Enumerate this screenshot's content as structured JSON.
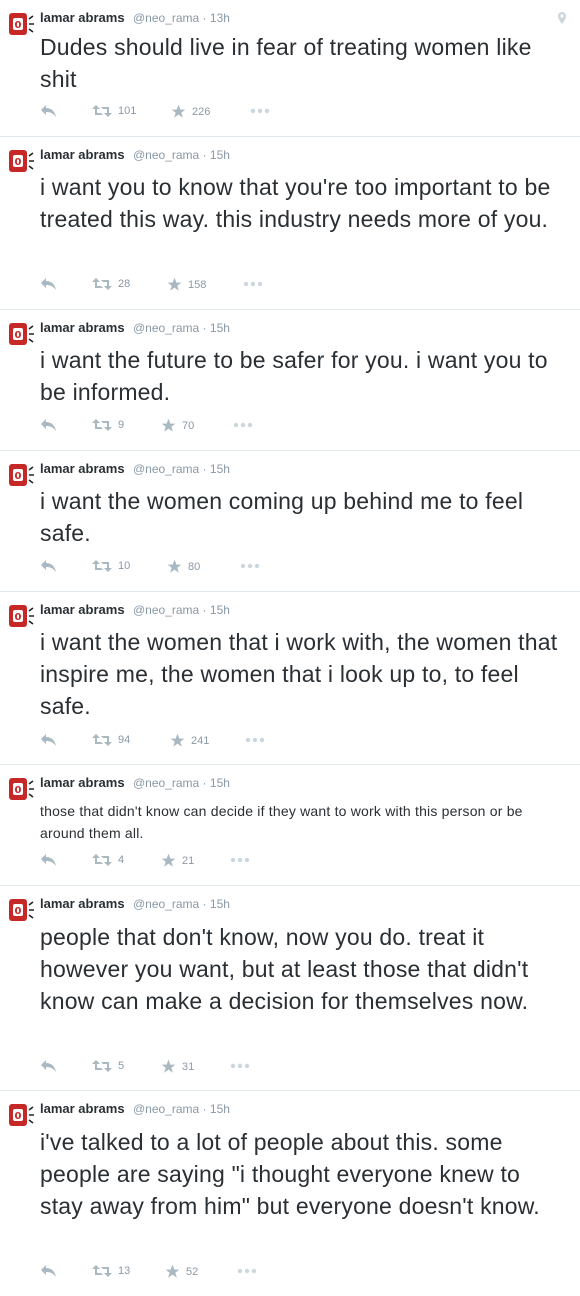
{
  "tweets": [
    {
      "name": "lamar abrams",
      "handle": "@neo_rama",
      "time": "13h",
      "text": "Dudes should live in fear of treating women like shit",
      "retweets": "101",
      "favorites": "226"
    },
    {
      "name": "lamar abrams",
      "handle": "@neo_rama",
      "time": "15h",
      "text": "i want you to know that you're too important to be treated this way. this industry needs more of you.",
      "retweets": "28",
      "favorites": "158"
    },
    {
      "name": "lamar abrams",
      "handle": "@neo_rama",
      "time": "15h",
      "text": "i want the future to be safer for you. i want you to be informed.",
      "retweets": "9",
      "favorites": "70"
    },
    {
      "name": "lamar abrams",
      "handle": "@neo_rama",
      "time": "15h",
      "text": "i want the women coming up behind me to feel safe.",
      "retweets": "10",
      "favorites": "80"
    },
    {
      "name": "lamar abrams",
      "handle": "@neo_rama",
      "time": "15h",
      "text": "i want the women that i work with, the women that inspire me, the women that i look up to, to feel safe.",
      "retweets": "94",
      "favorites": "241"
    },
    {
      "name": "lamar abrams",
      "handle": "@neo_rama",
      "time": "15h",
      "text": "those that didn't know can decide if they want to work with this person or be around them all.",
      "retweets": "4",
      "favorites": "21"
    },
    {
      "name": "lamar abrams",
      "handle": "@neo_rama",
      "time": "15h",
      "text": "people that don't know, now you do. treat it however you want, but at least those that didn't know can make a decision for themselves now.",
      "retweets": "5",
      "favorites": "31"
    },
    {
      "name": "lamar abrams",
      "handle": "@neo_rama",
      "time": "15h",
      "text": "i've talked to a lot of people about this. some people are saying \"i thought everyone knew to stay away from him\" but everyone doesn't know.",
      "retweets": "13",
      "favorites": "52"
    }
  ],
  "icons": {
    "reply": "reply-icon",
    "retweet": "retweet-icon",
    "favorite": "star-icon",
    "more": "more-icon",
    "geo": "location-pin-icon",
    "avatar": "avatar-icon"
  },
  "colors": {
    "text": "#292f33",
    "muted": "#8899a6",
    "icon": "#aab8c2",
    "divider": "#e1e8ed",
    "avatar": "#c0392b"
  }
}
